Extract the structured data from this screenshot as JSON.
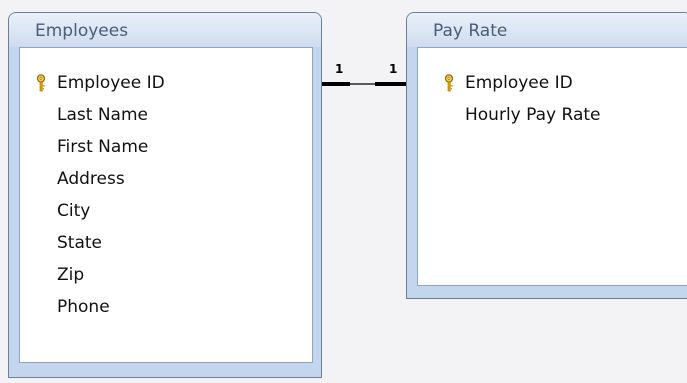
{
  "tables": [
    {
      "title": "Employees",
      "fields": [
        {
          "name": "Employee ID",
          "primary_key": true
        },
        {
          "name": "Last Name",
          "primary_key": false
        },
        {
          "name": "First Name",
          "primary_key": false
        },
        {
          "name": "Address",
          "primary_key": false
        },
        {
          "name": "City",
          "primary_key": false
        },
        {
          "name": "State",
          "primary_key": false
        },
        {
          "name": "Zip",
          "primary_key": false
        },
        {
          "name": "Phone",
          "primary_key": false
        }
      ]
    },
    {
      "title": "Pay Rate",
      "fields": [
        {
          "name": "Employee ID",
          "primary_key": true
        },
        {
          "name": "Hourly Pay Rate",
          "primary_key": false
        }
      ]
    }
  ],
  "relationship": {
    "left_cardinality": "1",
    "right_cardinality": "1"
  },
  "icons": {
    "primary_key": "key-icon"
  },
  "colors": {
    "canvas": "#f3f3f5",
    "table_frame": "#c3d6ee",
    "title_text": "#4a5d78",
    "key_gold": "#d8a31a"
  }
}
